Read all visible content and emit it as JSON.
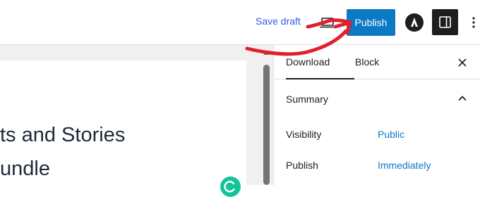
{
  "header": {
    "save_draft_label": "Save draft",
    "publish_label": "Publish"
  },
  "editor": {
    "title_lines": [
      "ts and Stories",
      "undle"
    ]
  },
  "sidebar": {
    "tabs": [
      {
        "label": "Download"
      },
      {
        "label": "Block"
      }
    ],
    "summary": {
      "title": "Summary",
      "rows": [
        {
          "label": "Visibility",
          "value": "Public"
        },
        {
          "label": "Publish",
          "value": "Immediately"
        }
      ]
    }
  },
  "colors": {
    "accent": "#0a7ac4",
    "link": "#3858e9",
    "annotation_arrow": "#e0202f",
    "grammarly": "#15c39a"
  },
  "icons": [
    "desktop-preview-icon",
    "astra-logo-icon",
    "sidebar-toggle-icon",
    "more-options-icon",
    "close-icon",
    "chevron-up-icon",
    "grammarly-icon"
  ]
}
